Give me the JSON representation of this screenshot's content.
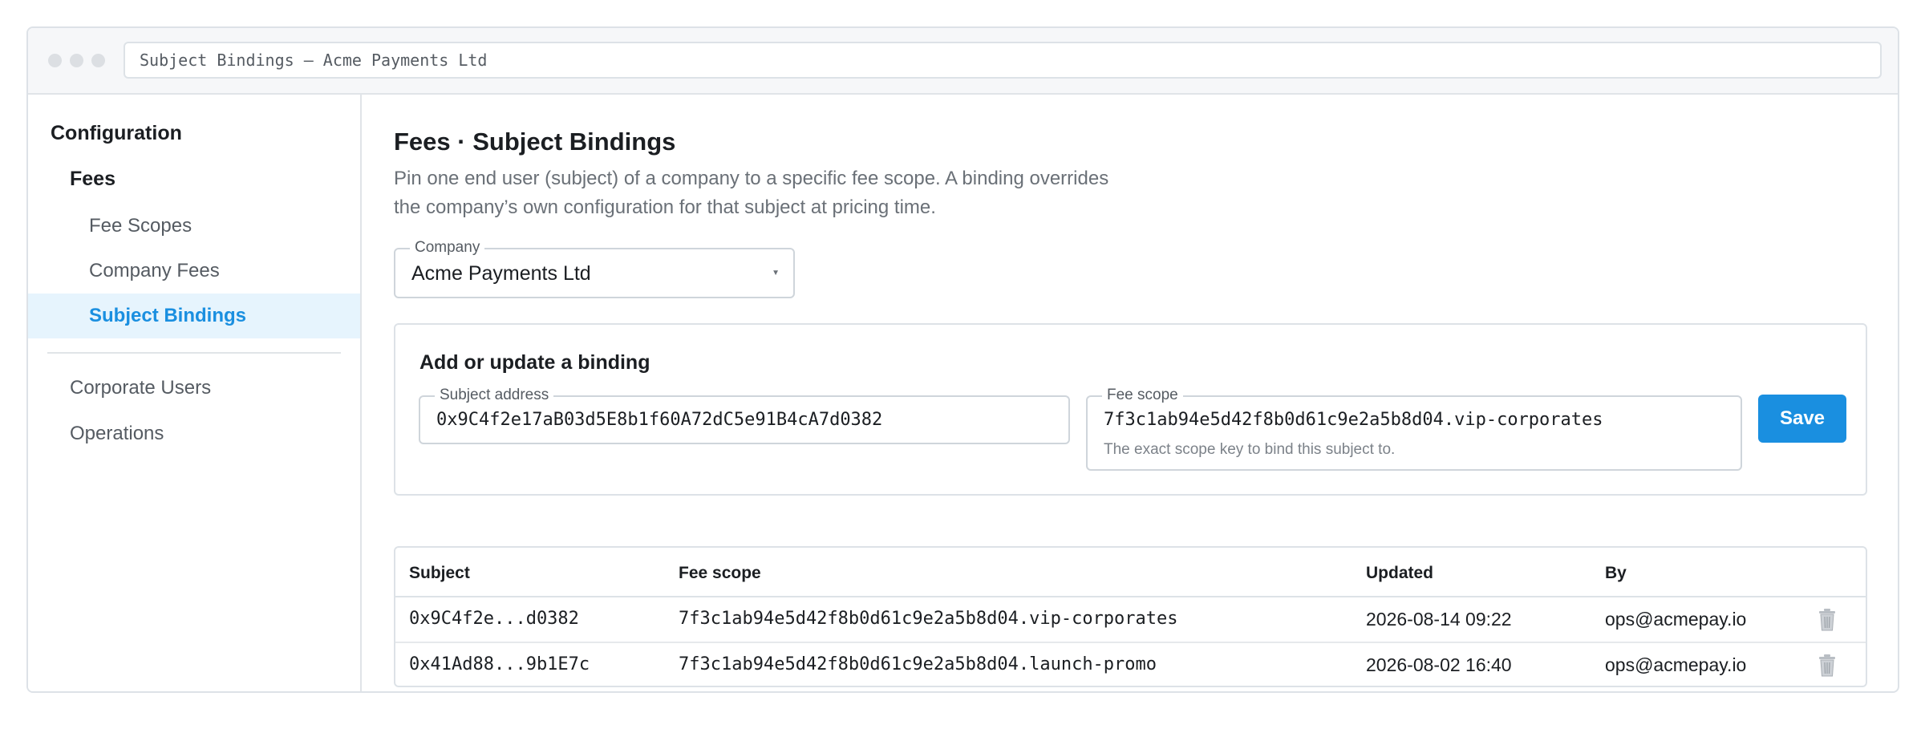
{
  "window": {
    "address": "Subject Bindings — Acme Payments Ltd"
  },
  "sidebar": {
    "section": "Configuration",
    "group": "Fees",
    "items": [
      "Fee Scopes",
      "Company Fees",
      "Subject Bindings"
    ],
    "active": "Subject Bindings",
    "other": [
      "Corporate Users",
      "Operations"
    ]
  },
  "page": {
    "title": "Fees · Subject Bindings",
    "description": "Pin one end user (subject) of a company to a specific fee scope. A binding overrides the company’s own configuration for that subject at pricing time."
  },
  "company": {
    "label": "Company",
    "value": "Acme Payments Ltd"
  },
  "form": {
    "title": "Add or update a binding",
    "subject_label": "Subject address",
    "subject_value": "0x9C4f2e17aB03d5E8b1f60A72dC5e91B4cA7d0382",
    "scope_label": "Fee scope",
    "scope_value": "7f3c1ab94e5d42f8b0d61c9e2a5b8d04.vip-corporates",
    "scope_helper": "The exact scope key to bind this subject to.",
    "save_label": "Save"
  },
  "table": {
    "headers": [
      "Subject",
      "Fee scope",
      "Updated",
      "By"
    ],
    "rows": [
      {
        "subject": "0x9C4f2e...d0382",
        "scope": "7f3c1ab94e5d42f8b0d61c9e2a5b8d04.vip-corporates",
        "updated": "2026-08-14 09:22",
        "by": "ops@acmepay.io"
      },
      {
        "subject": "0x41Ad88...9b1E7c",
        "scope": "7f3c1ab94e5d42f8b0d61c9e2a5b8d04.launch-promo",
        "updated": "2026-08-02 16:40",
        "by": "ops@acmepay.io"
      }
    ]
  },
  "colors": {
    "accent": "#1a8fe0",
    "active_bg": "#e6f4fd",
    "border": "#dde2e7"
  },
  "icons": {
    "row_action": "trash-icon",
    "dropdown": "chevron-down-icon"
  }
}
